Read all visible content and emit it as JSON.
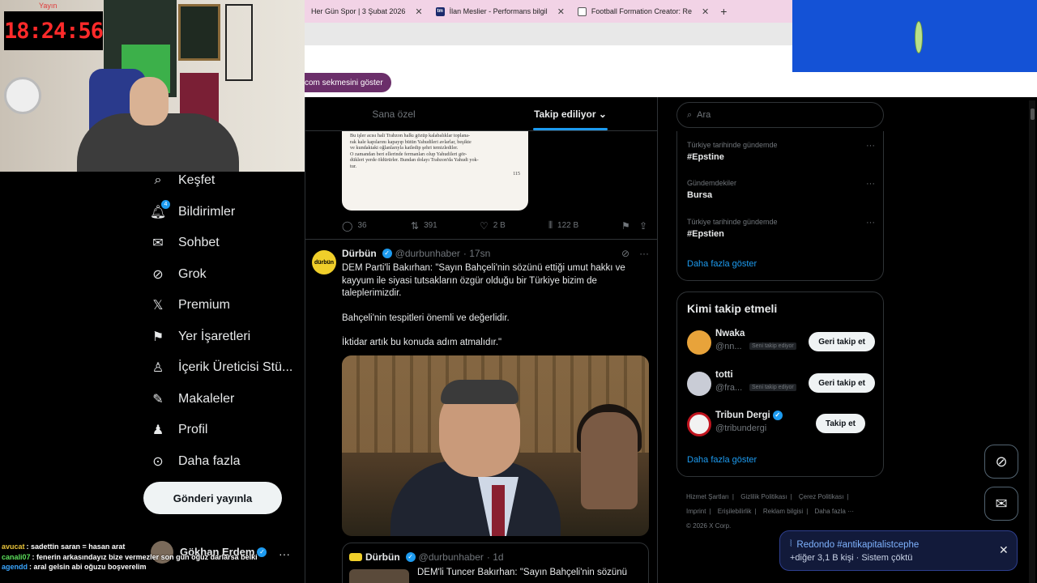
{
  "browser": {
    "tabs": [
      {
        "label": "Her Gün Spor | 3 Şubat 2026",
        "favicon": ""
      },
      {
        "label": "İlan Meslier - Performans bilgil",
        "favicon": "tm"
      },
      {
        "label": "Football Formation Creator: Re",
        "favicon": ""
      }
    ],
    "show_tab_pill": "com sekmesini göster"
  },
  "stream": {
    "clock_label": "Yayın",
    "clock": "18:24:56"
  },
  "nav": {
    "items": [
      {
        "label": "Keşfet",
        "icon": "search-icon"
      },
      {
        "label": "Bildirimler",
        "icon": "bell-icon",
        "badge": "4"
      },
      {
        "label": "Sohbet",
        "icon": "envelope-icon"
      },
      {
        "label": "Grok",
        "icon": "grok-icon"
      },
      {
        "label": "Premium",
        "icon": "x-logo-icon"
      },
      {
        "label": "Yer İşaretleri",
        "icon": "bookmark-icon"
      },
      {
        "label": "İçerik Üreticisi Stü...",
        "icon": "creator-studio-icon"
      },
      {
        "label": "Makaleler",
        "icon": "article-icon"
      },
      {
        "label": "Profil",
        "icon": "profile-icon"
      },
      {
        "label": "Daha fazla",
        "icon": "more-circle-icon"
      }
    ],
    "post_button": "Gönderi yayınla",
    "account_name": "Gökhan Erdem"
  },
  "chat": [
    {
      "user": "avucat",
      "message": ": sadettin saran = hasan arat",
      "color": "#e8c33a"
    },
    {
      "user": "canali07",
      "message": ": fenerin arkasındayız bize vermezler son gün oğuz darlarsa belki",
      "color": "#5ce05c"
    },
    {
      "user": "agendd",
      "message": ": aral gelsin abi oğuzu boşverelim",
      "color": "#3aa6ff"
    }
  ],
  "main": {
    "tabs": [
      "Sana özel",
      "Takip ediliyor"
    ],
    "post1": {
      "book_lines": [
        "Bu işler acısı hali Trabzon halkı gözüp kalabalıklar toplana-",
        "rak kale kapılarını kapayıp bütün Yahudileri avlarlar, beşikte",
        "ve kundaktaki oğlanlarıyla katledip şehri temizlediler.",
        "O zamandan beri ellerinde fermanları olup Yahudileri gör-",
        "dükleri yerde öldürürler. Bundan dolayı Trabzon'da Yahudi yok-",
        "tur."
      ],
      "page_number": "115",
      "actions": {
        "replies": "36",
        "reposts": "391",
        "likes": "2 B",
        "views": "122 B"
      }
    },
    "post2": {
      "avatar_text": "dürbün",
      "name": "Dürbün",
      "handle": "@durbunhaber",
      "time": "· 17sn",
      "text": [
        "DEM Parti'li Bakırhan: \"Sayın Bahçeli'nin sözünü ettiği umut hakkı ve kayyum ile siyasi tutsakların özgür olduğu bir Türkiye bizim de taleplerimizdir.",
        "Bahçeli'nin tespitleri önemli ve değerlidir.",
        "İktidar artık bu konuda adım atmalıdır.\""
      ],
      "quote": {
        "name": "Dürbün",
        "handle": "@durbunhaber",
        "time": "· 1d",
        "text": "DEM'li Tuncer Bakırhan: \"Sayın Bahçeli'nin sözünü"
      }
    }
  },
  "right": {
    "search_placeholder": "Ara",
    "trends": [
      {
        "context": "Türkiye tarihinde gündemde",
        "name": "#Epstine"
      },
      {
        "context": "Gündemdekiler",
        "name": "Bursa"
      },
      {
        "context": "Türkiye tarihinde gündemde",
        "name": "#Epstien"
      }
    ],
    "trends_more": "Daha fazla göster",
    "who_to_follow": {
      "title": "Kimi takip etmeli",
      "items": [
        {
          "name": "Nwaka",
          "handle": "@nn...",
          "follows_you": "Seni takip ediyor",
          "button": "Geri takip et",
          "avatar_color": "#e8a33a"
        },
        {
          "name": "totti",
          "handle": "@fra...",
          "follows_you": "Seni takip ediyor",
          "button": "Geri takip et",
          "avatar_color": "#c9ccd6"
        },
        {
          "name": "Tribun Dergi",
          "handle": "@tribundergi",
          "follows_you": "",
          "button": "Takip et",
          "avatar_color": "#f2f2f2"
        }
      ],
      "more": "Daha fazla göster"
    },
    "footer": {
      "row1": [
        "Hizmet Şartları",
        "Gizlilik Politikası",
        "Çerez Politikası"
      ],
      "row2": [
        "Imprint",
        "Erişilebilirlik",
        "Reklam bilgisi",
        "Daha fazla ···"
      ],
      "copyright": "© 2026 X Corp."
    }
  },
  "toast": {
    "line1": "Redondo #antikapitalistcephe",
    "line2": "+diğer 3,1 B kişi · Sistem çöktü"
  },
  "colors": {
    "accent": "#1d9bf0",
    "background": "#000000",
    "border": "#2f3336",
    "muted_text": "#71767b"
  }
}
